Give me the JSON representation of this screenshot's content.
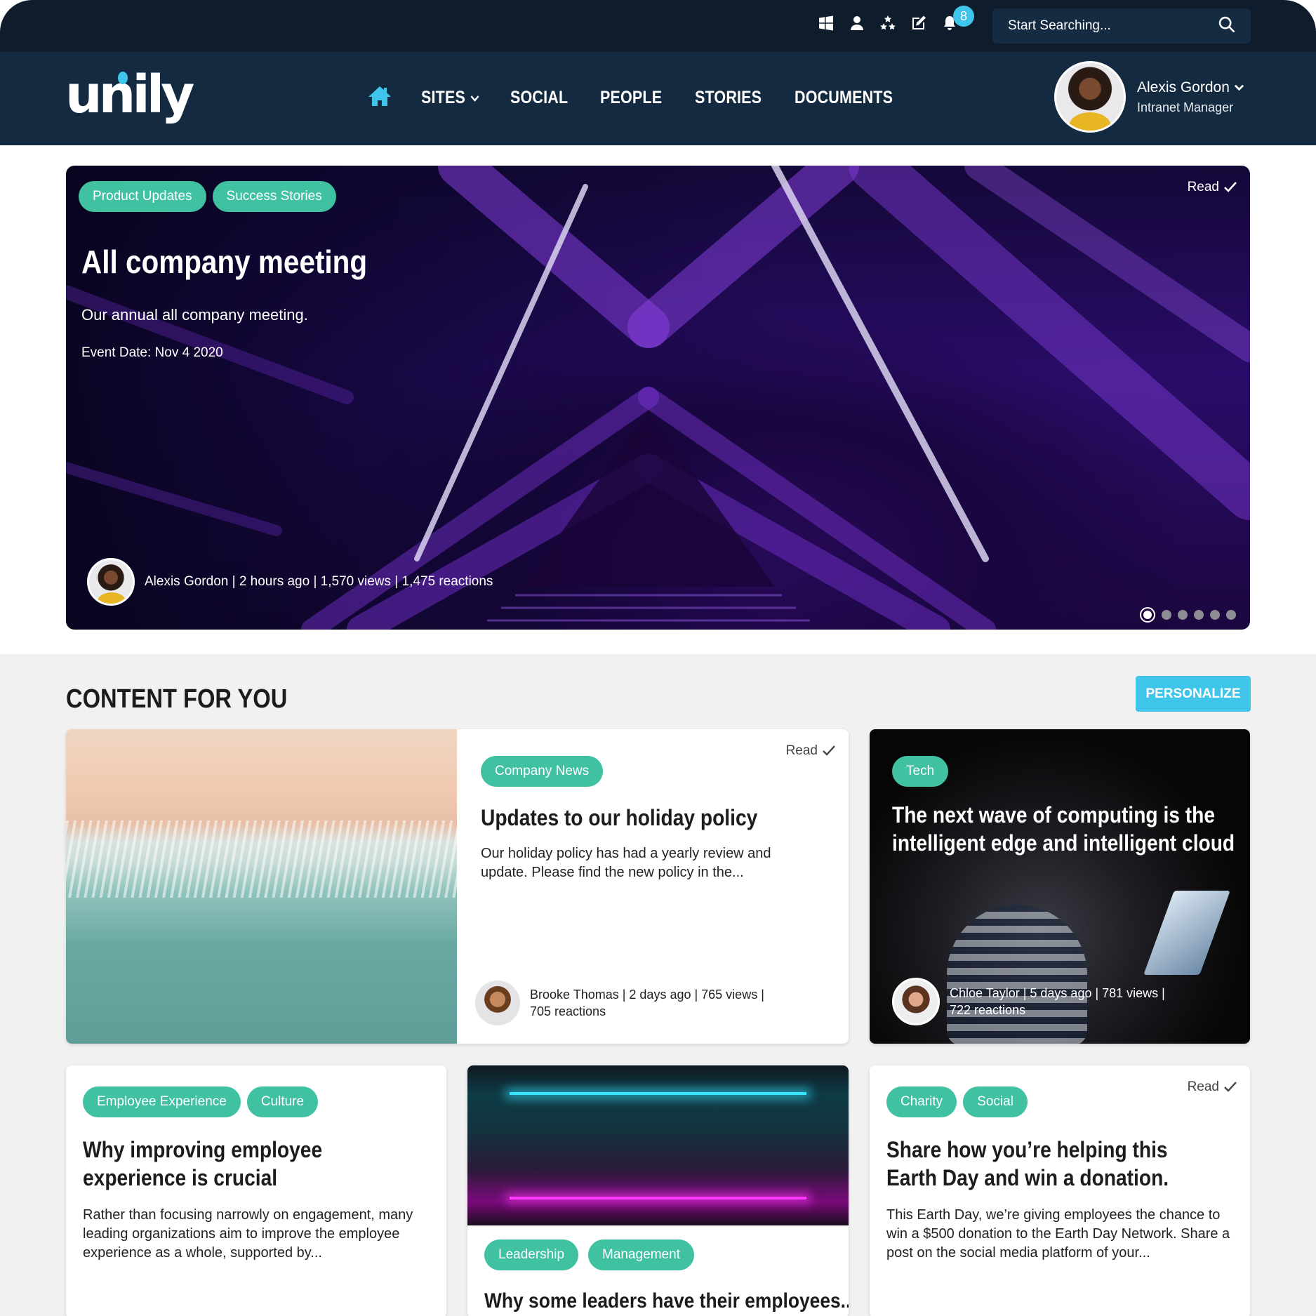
{
  "topbar": {
    "icons": [
      "windows-icon",
      "user-icon",
      "stars-icon",
      "edit-icon",
      "bell-icon"
    ],
    "notification_count": "8",
    "search_placeholder": "Start Searching..."
  },
  "navbar": {
    "logo": "unily",
    "items": [
      {
        "label": "SITES",
        "has_dropdown": true
      },
      {
        "label": "SOCIAL"
      },
      {
        "label": "PEOPLE"
      },
      {
        "label": "STORIES"
      },
      {
        "label": "DOCUMENTS"
      }
    ],
    "user": {
      "name": "Alexis Gordon",
      "role": "Intranet Manager"
    }
  },
  "hero": {
    "tags": [
      "Product Updates",
      "Success Stories"
    ],
    "title": "All company meeting",
    "subtitle": "Our annual all company meeting.",
    "event_date": "Event Date: Nov 4 2020",
    "read_label": "Read",
    "meta": "Alexis Gordon | 2 hours ago | 1,570 views | 1,475 reactions",
    "carousel": {
      "total": 6,
      "active": 1
    }
  },
  "content": {
    "title": "CONTENT FOR YOU",
    "personalize_label": "PERSONALIZE",
    "cards": [
      {
        "tags": [
          "Company News"
        ],
        "read_label": "Read",
        "title": "Updates to our holiday policy",
        "body": "Our holiday policy has had a yearly review and update. Please find the new policy in the...",
        "meta_line1": "Brooke Thomas | 2 days ago | 765 views |",
        "meta_line2": "705 reactions"
      },
      {
        "tags": [
          "Tech"
        ],
        "title": "The next wave of computing is the intelligent edge and intelligent cloud",
        "meta_line1": "Chloe Taylor | 5 days ago | 781 views |",
        "meta_line2": "722 reactions"
      },
      {
        "tags": [
          "Employee Experience",
          "Culture"
        ],
        "title": "Why improving employee experience is crucial",
        "body": "Rather than focusing narrowly on engagement, many leading organizations aim to improve the employee experience as a whole, supported by..."
      },
      {
        "tags": [
          "Leadership",
          "Management"
        ],
        "title": "Why some leaders have their employees..."
      },
      {
        "tags": [
          "Charity",
          "Social"
        ],
        "read_label": "Read",
        "title": "Share how you’re helping this Earth Day and win a donation.",
        "body": "This Earth Day, we’re giving employees the chance to win a $500 donation to the Earth Day Network. Share a post on the social media platform of your..."
      }
    ]
  },
  "colors": {
    "topbar_bg": "#0f1c2c",
    "navbar_bg": "#132a40",
    "accent": "#3fc4ea",
    "tag": "#40c1a2",
    "section_bg": "#f1f1f1"
  }
}
